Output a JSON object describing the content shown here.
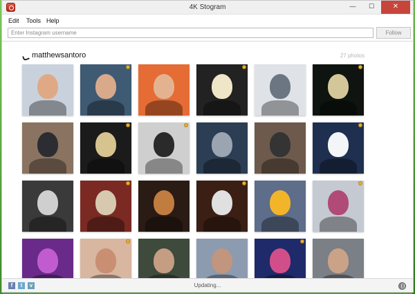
{
  "window": {
    "title": "4K Stogram",
    "minimize_glyph": "—",
    "maximize_glyph": "☐",
    "close_glyph": "✕"
  },
  "menu": {
    "items": [
      {
        "label": "Edit"
      },
      {
        "label": "Tools"
      },
      {
        "label": "Help"
      }
    ]
  },
  "toolbar": {
    "username_placeholder": "Enter Instagram username",
    "username_value": "",
    "follow_label": "Follow"
  },
  "profile": {
    "username": "matthewsantoro",
    "photo_count": "27 photos"
  },
  "photos": [
    {
      "id": 1,
      "bg": "#c9d2dc",
      "accent": "#e0a986",
      "star": false
    },
    {
      "id": 2,
      "bg": "#3f5b73",
      "accent": "#d9a98c",
      "star": true
    },
    {
      "id": 3,
      "bg": "#e56c34",
      "accent": "#e3b391",
      "star": false
    },
    {
      "id": 4,
      "bg": "#222222",
      "accent": "#efe6c8",
      "star": true
    },
    {
      "id": 5,
      "bg": "#dfe3e8",
      "accent": "#6c7682",
      "star": false
    },
    {
      "id": 6,
      "bg": "#0f1410",
      "accent": "#d3c79a",
      "star": true
    },
    {
      "id": 7,
      "bg": "#8a7360",
      "accent": "#2c2d33",
      "star": false
    },
    {
      "id": 8,
      "bg": "#1b1b1b",
      "accent": "#d7c38e",
      "star": true
    },
    {
      "id": 9,
      "bg": "#cfcfcf",
      "accent": "#2a2a2a",
      "star": true
    },
    {
      "id": 10,
      "bg": "#2c3e54",
      "accent": "#9aa5b1",
      "star": false
    },
    {
      "id": 11,
      "bg": "#6d5a4c",
      "accent": "#343434",
      "star": false
    },
    {
      "id": 12,
      "bg": "#1f2f4f",
      "accent": "#f3f5f8",
      "star": true
    },
    {
      "id": 13,
      "bg": "#3a3a3a",
      "accent": "#cfcfcf",
      "star": false
    },
    {
      "id": 14,
      "bg": "#7a2a22",
      "accent": "#d6c9b0",
      "star": true
    },
    {
      "id": 15,
      "bg": "#2a1b14",
      "accent": "#c17d3f",
      "star": false
    },
    {
      "id": 16,
      "bg": "#3b1f14",
      "accent": "#e0e0e0",
      "star": true
    },
    {
      "id": 17,
      "bg": "#5d6d8a",
      "accent": "#f2b52a",
      "star": false
    },
    {
      "id": 18,
      "bg": "#c4c9d2",
      "accent": "#b04a77",
      "star": true
    },
    {
      "id": 19,
      "bg": "#6a2a8a",
      "accent": "#c05cd0",
      "star": false
    },
    {
      "id": 20,
      "bg": "#d8b6a0",
      "accent": "#c98f73",
      "star": true
    },
    {
      "id": 21,
      "bg": "#3d4a3c",
      "accent": "#c49d83",
      "star": false
    },
    {
      "id": 22,
      "bg": "#8c9bb0",
      "accent": "#c2957e",
      "star": false
    },
    {
      "id": 23,
      "bg": "#1e2a6a",
      "accent": "#d24e8a",
      "star": true
    },
    {
      "id": 24,
      "bg": "#7b7f86",
      "accent": "#caa288",
      "star": false
    }
  ],
  "statusbar": {
    "status": "Updating...",
    "facebook_glyph": "f",
    "twitter_glyph": "t",
    "vimeo_glyph": "v"
  },
  "colors": {
    "close_button": "#c7453b",
    "accent_star": "#e2b23a"
  }
}
